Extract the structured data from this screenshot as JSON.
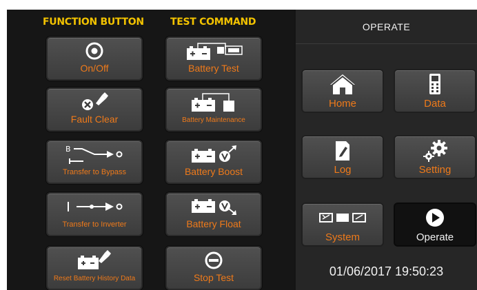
{
  "headers": {
    "function": "FUNCTION BUTTON",
    "test": "TEST COMMAND",
    "operate": "OPERATE"
  },
  "function_buttons": [
    {
      "label": "On/Off",
      "icon": "power-icon"
    },
    {
      "label": "Fault Clear",
      "icon": "fault-clear-icon"
    },
    {
      "label": "Transfer to Bypass",
      "icon": "bypass-switch-icon",
      "glyph": "B"
    },
    {
      "label": "Transfer to Inverter",
      "icon": "inverter-switch-icon"
    },
    {
      "label": "Reset Battery History Data",
      "icon": "battery-reset-icon"
    }
  ],
  "test_buttons": [
    {
      "label": "Battery Test",
      "icon": "battery-test-icon"
    },
    {
      "label": "Battery Maintenance",
      "icon": "battery-maintenance-icon"
    },
    {
      "label": "Battery Boost",
      "icon": "battery-boost-icon"
    },
    {
      "label": "Battery Float",
      "icon": "battery-float-icon"
    },
    {
      "label": "Stop Test",
      "icon": "stop-icon"
    }
  ],
  "nav_buttons": [
    {
      "label": "Home",
      "icon": "home-icon"
    },
    {
      "label": "Data",
      "icon": "data-meter-icon"
    },
    {
      "label": "Log",
      "icon": "log-icon"
    },
    {
      "label": "Setting",
      "icon": "gear-icon"
    },
    {
      "label": "System",
      "icon": "system-icon"
    },
    {
      "label": "Operate",
      "icon": "play-icon",
      "selected": true
    }
  ],
  "datetime": "01/06/2017 19:50:23",
  "colors": {
    "accent": "#ef7a1a",
    "header": "#f2c200",
    "icon": "#ffffff"
  }
}
